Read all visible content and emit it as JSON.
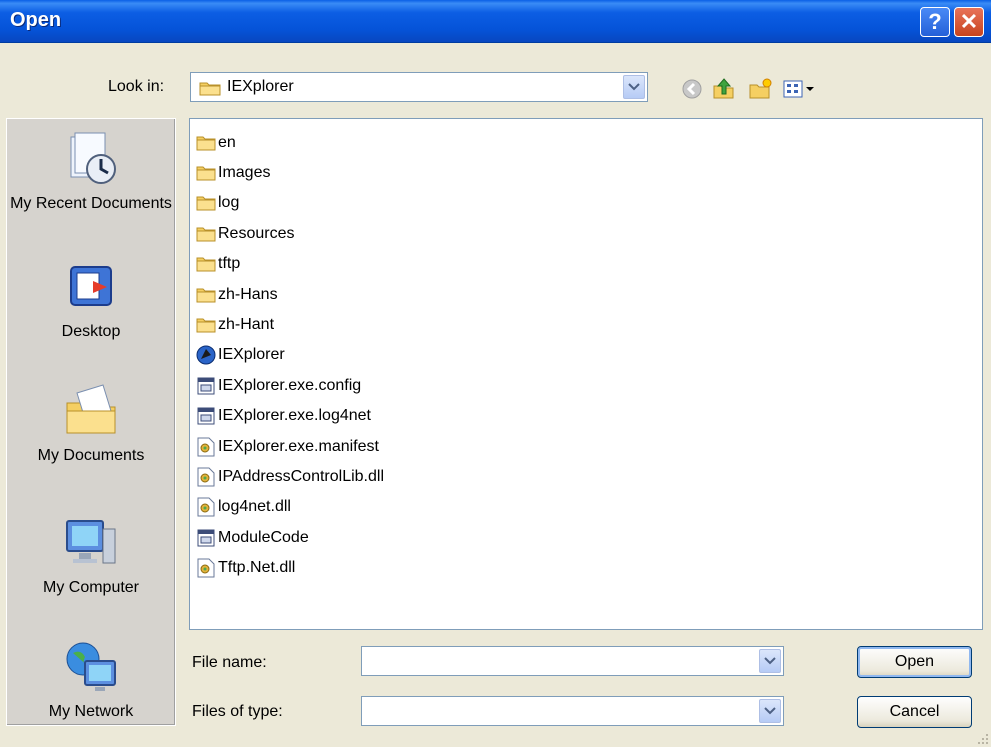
{
  "dialog": {
    "title": "Open"
  },
  "titlebar": {
    "help_label": "?",
    "close_label": "✕"
  },
  "lookin": {
    "label": "Look in:",
    "value": "IEXplorer"
  },
  "toolbar": {
    "icons": [
      "back-icon",
      "up-folder-icon",
      "new-folder-icon",
      "views-menu-icon"
    ]
  },
  "places": [
    {
      "label": "My Recent Documents",
      "icon": "recent-documents-icon"
    },
    {
      "label": "Desktop",
      "icon": "desktop-icon"
    },
    {
      "label": "My Documents",
      "icon": "my-documents-icon"
    },
    {
      "label": "My Computer",
      "icon": "my-computer-icon"
    },
    {
      "label": "My Network",
      "icon": "my-network-icon"
    }
  ],
  "files": [
    {
      "name": "en",
      "type": "folder"
    },
    {
      "name": "Images",
      "type": "folder"
    },
    {
      "name": "log",
      "type": "folder"
    },
    {
      "name": "Resources",
      "type": "folder"
    },
    {
      "name": "tftp",
      "type": "folder"
    },
    {
      "name": "zh-Hans",
      "type": "folder"
    },
    {
      "name": "zh-Hant",
      "type": "folder"
    },
    {
      "name": "IEXplorer",
      "type": "app"
    },
    {
      "name": "IEXplorer.exe.config",
      "type": "config"
    },
    {
      "name": "IEXplorer.exe.log4net",
      "type": "config"
    },
    {
      "name": "IEXplorer.exe.manifest",
      "type": "dll"
    },
    {
      "name": "IPAddressControlLib.dll",
      "type": "dll"
    },
    {
      "name": "log4net.dll",
      "type": "dll"
    },
    {
      "name": "ModuleCode",
      "type": "config"
    },
    {
      "name": "Tftp.Net.dll",
      "type": "dll"
    }
  ],
  "filename": {
    "label": "File name:",
    "value": ""
  },
  "filetype": {
    "label": "Files of type:",
    "value": ""
  },
  "buttons": {
    "open": "Open",
    "cancel": "Cancel"
  },
  "colors": {
    "titlebar": "#0553d8",
    "dialog_bg": "#ece9d8",
    "folder": "#f5cf62"
  }
}
